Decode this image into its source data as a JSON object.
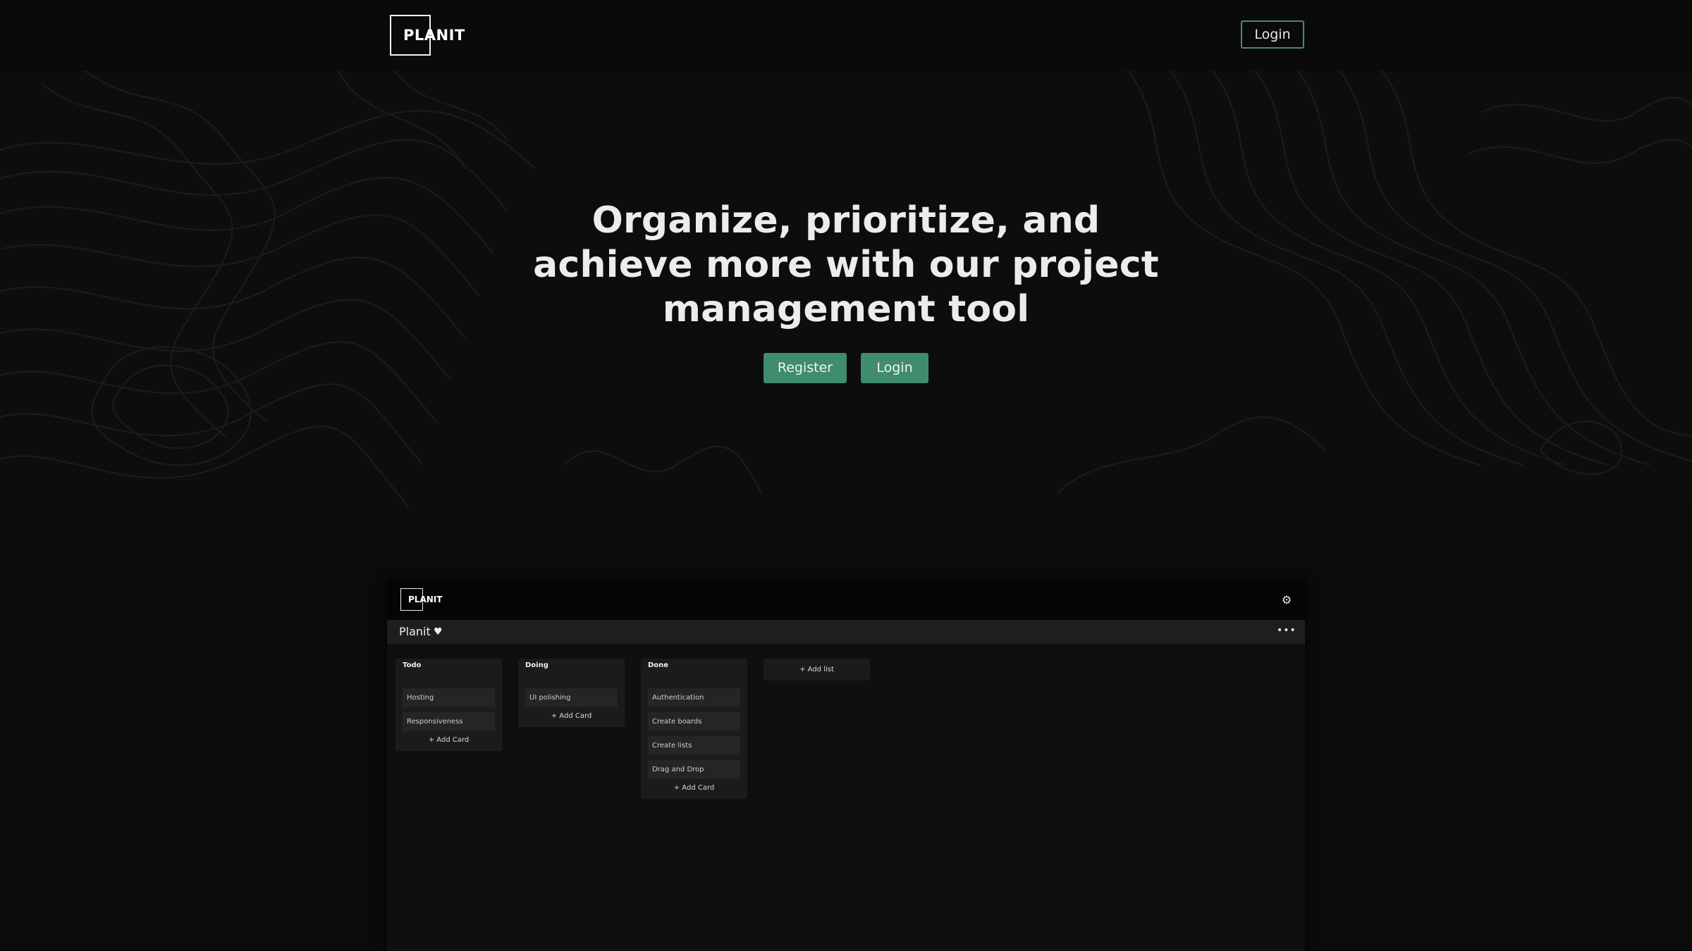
{
  "header": {
    "logo_text": "PLANIT",
    "login_label": "Login"
  },
  "hero": {
    "title": "Organize, prioritize, and achieve more with our project management tool",
    "register_label": "Register",
    "login_label": "Login"
  },
  "preview": {
    "logo_text": "PLANIT",
    "gear_icon": "gear-icon",
    "board_title": "Planit",
    "heart_icon": "heart-icon",
    "menu_icon": "more-horizontal-icon",
    "lists": [
      {
        "title": "Todo",
        "cards": [
          "Hosting",
          "Responsiveness"
        ],
        "add_card_label": "+ Add Card"
      },
      {
        "title": "Doing",
        "cards": [
          "UI polishing"
        ],
        "add_card_label": "+ Add Card"
      },
      {
        "title": "Done",
        "cards": [
          "Authentication",
          "Create boards",
          "Create lists",
          "Drag and Drop"
        ],
        "add_card_label": "+ Add Card"
      }
    ],
    "add_list_label": "+ Add list"
  },
  "colors": {
    "accent": "#3f8c6e",
    "background": "#0b0b0b",
    "hero_background": "#0d0d0d"
  }
}
